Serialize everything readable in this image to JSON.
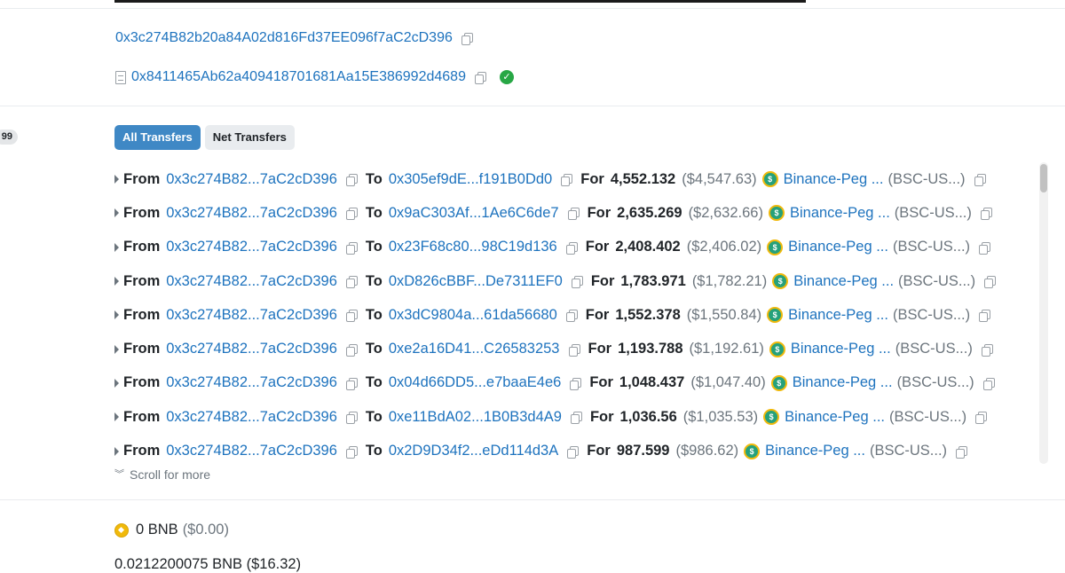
{
  "header": {
    "from_address": "0x3c274B82b20a84A02d816Fd37EE096f7aC2cD396",
    "contract_address": "0x8411465Ab62a409418701681Aa15E386992d4689"
  },
  "side_badge": "99",
  "tabs": [
    {
      "label": "All Transfers",
      "active": true
    },
    {
      "label": "Net Transfers",
      "active": false
    }
  ],
  "transfers": {
    "from_label": "From",
    "to_label": "To",
    "for_label": "For",
    "token_name": "Binance-Peg ...",
    "token_symbol": "(BSC-US...)",
    "rows": [
      {
        "from": "0x3c274B82...7aC2cD396",
        "to": "0x305ef9dE...f191B0Dd0",
        "amount": "4,552.132",
        "usd": "($4,547.63)"
      },
      {
        "from": "0x3c274B82...7aC2cD396",
        "to": "0x9aC303Af...1Ae6C6de7",
        "amount": "2,635.269",
        "usd": "($2,632.66)"
      },
      {
        "from": "0x3c274B82...7aC2cD396",
        "to": "0x23F68c80...98C19d136",
        "amount": "2,408.402",
        "usd": "($2,406.02)"
      },
      {
        "from": "0x3c274B82...7aC2cD396",
        "to": "0xD826cBBF...De7311EF0",
        "amount": "1,783.971",
        "usd": "($1,782.21)"
      },
      {
        "from": "0x3c274B82...7aC2cD396",
        "to": "0x3dC9804a...61da56680",
        "amount": "1,552.378",
        "usd": "($1,550.84)"
      },
      {
        "from": "0x3c274B82...7aC2cD396",
        "to": "0xe2a16D41...C26583253",
        "amount": "1,193.788",
        "usd": "($1,192.61)"
      },
      {
        "from": "0x3c274B82...7aC2cD396",
        "to": "0x04d66DD5...e7baaE4e6",
        "amount": "1,048.437",
        "usd": "($1,047.40)"
      },
      {
        "from": "0x3c274B82...7aC2cD396",
        "to": "0xe11BdA02...1B0B3d4A9",
        "amount": "1,036.56",
        "usd": "($1,035.53)"
      },
      {
        "from": "0x3c274B82...7aC2cD396",
        "to": "0x2D9D34f2...eDd114d3A",
        "amount": "987.599",
        "usd": "($986.62)"
      }
    ]
  },
  "scroll_more": "Scroll for more",
  "value": {
    "amount": "0 BNB",
    "usd": "($0.00)"
  },
  "fee_partial": "0.0212200075 BNB ($16.32)",
  "icons": {
    "copy": "copy-icon",
    "contract": "file-icon",
    "verified": "check-circle-icon",
    "token": "tether-icon",
    "bnb": "bnb-icon",
    "expand": "caret-right-icon",
    "scroll": "double-chevron-down-icon"
  },
  "colors": {
    "link": "#1e73be",
    "active_tab": "#3f88c5",
    "verified": "#28a745",
    "bnb": "#f0b90b"
  }
}
